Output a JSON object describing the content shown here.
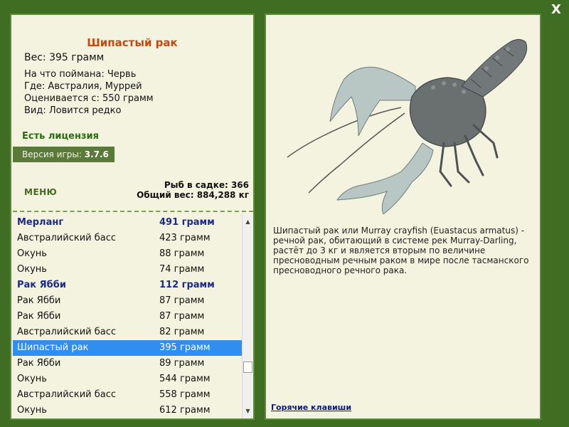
{
  "window": {
    "close_glyph": "X"
  },
  "fish": {
    "name": "Шипастый рак",
    "weight": "Вес: 395 грамм",
    "bait": "На что поймана: Червь",
    "location": "Где: Австралия, Муррей",
    "valued_from": "Оценивается с: 550 грамм",
    "rarity": "Вид: Ловится редко"
  },
  "license": "Есть лицензия",
  "version": {
    "label": "Версия игры:",
    "value": "3.7.6"
  },
  "menu_label": "МЕНЮ",
  "keepnet": {
    "count_line": "Рыб в садке: 366",
    "total_line": "Общий вес: 884,288 кг"
  },
  "list": [
    {
      "name": "Мерланг",
      "weight": "491 грамм",
      "kind": "header"
    },
    {
      "name": "Австралийский басс",
      "weight": "423 грамм",
      "kind": "item"
    },
    {
      "name": "Окунь",
      "weight": "88 грамм",
      "kind": "item"
    },
    {
      "name": "Окунь",
      "weight": "74 грамм",
      "kind": "item"
    },
    {
      "name": "Рак Ябби",
      "weight": "112 грамм",
      "kind": "header"
    },
    {
      "name": "Рак Ябби",
      "weight": "87 грамм",
      "kind": "item"
    },
    {
      "name": "Рак Ябби",
      "weight": "87 грамм",
      "kind": "item"
    },
    {
      "name": "Австралийский басс",
      "weight": "82 грамм",
      "kind": "item"
    },
    {
      "name": "Шипастый рак",
      "weight": "395 грамм",
      "kind": "selected"
    },
    {
      "name": "Рак Ябби",
      "weight": "89 грамм",
      "kind": "item"
    },
    {
      "name": "Окунь",
      "weight": "544 грамм",
      "kind": "item"
    },
    {
      "name": "Австралийский басс",
      "weight": "558 грамм",
      "kind": "item"
    },
    {
      "name": "Окунь",
      "weight": "612 грамм",
      "kind": "item"
    }
  ],
  "description": "Шипастый рак или Murray crayfish (Euastacus armatus) - речной рак, обитающий в системе рек Murray-Darling, растёт до 3 кг и является вторым по величине пресноводным речным раком в мире после тасманского пресноводного речного рака.",
  "hotkeys_label": "Горячие клавиши",
  "icons": {
    "close": "close-icon",
    "scroll_up": "arrow-up-icon",
    "scroll_down": "arrow-down-icon"
  }
}
